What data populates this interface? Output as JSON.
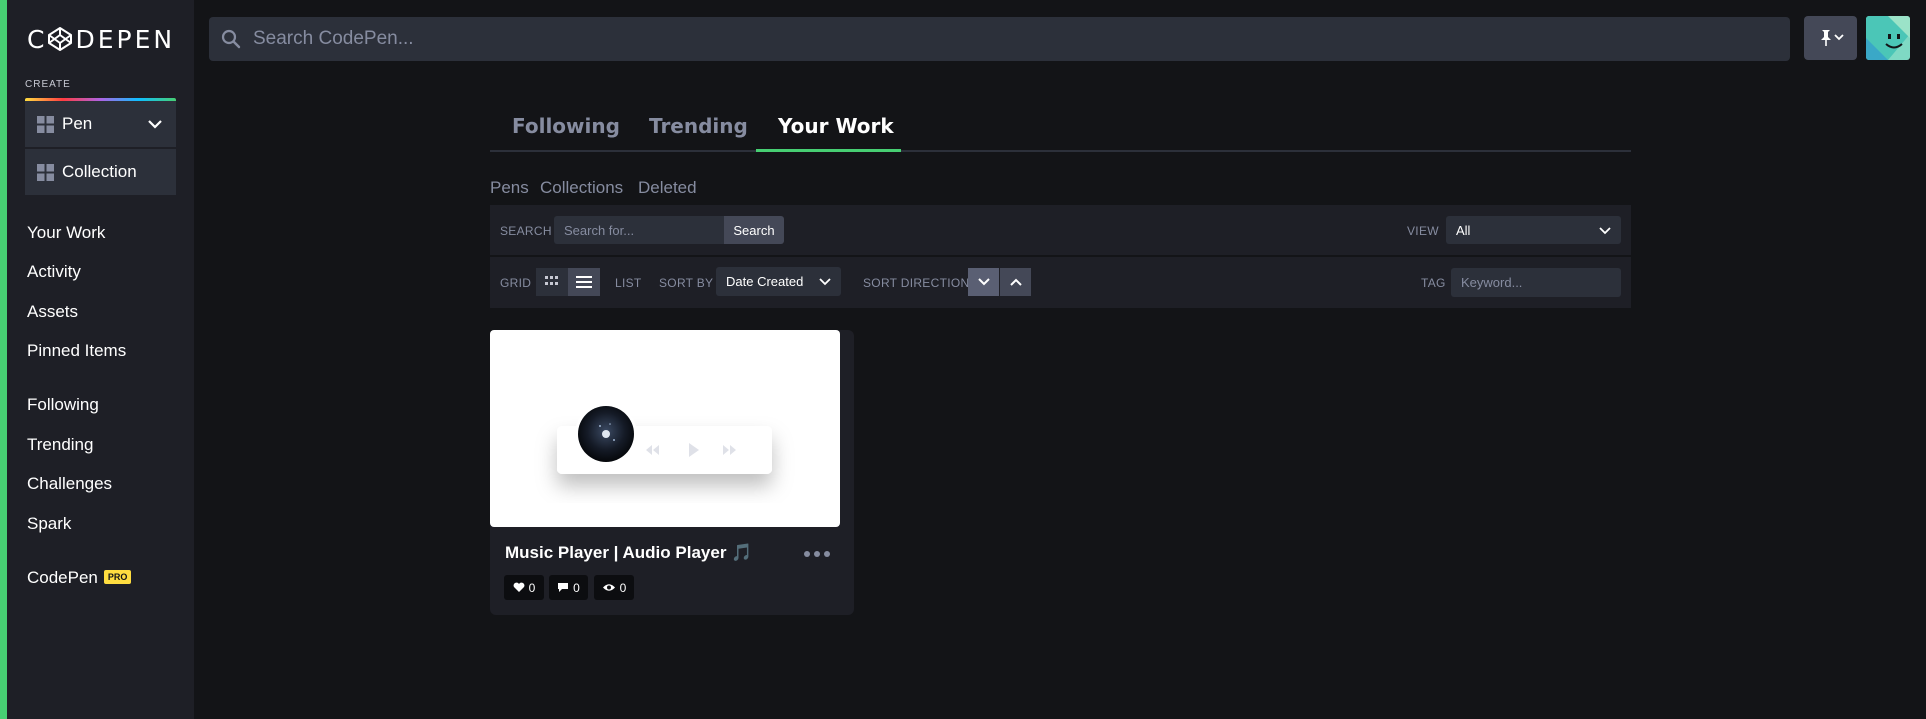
{
  "brand": {
    "logo_text": "DEPEN"
  },
  "sidebar": {
    "create_label": "CREATE",
    "create_items": [
      {
        "label": "Pen"
      },
      {
        "label": "Collection"
      }
    ],
    "nav_items": [
      {
        "label": "Your Work"
      },
      {
        "label": "Activity"
      },
      {
        "label": "Assets"
      },
      {
        "label": "Pinned Items"
      },
      {
        "label": "Following"
      },
      {
        "label": "Trending"
      },
      {
        "label": "Challenges"
      },
      {
        "label": "Spark"
      },
      {
        "label": "CodePen"
      }
    ],
    "pro_badge": "PRO"
  },
  "header": {
    "search_placeholder": "Search CodePen..."
  },
  "tabs": [
    {
      "label": "Following",
      "active": false
    },
    {
      "label": "Trending",
      "active": false
    },
    {
      "label": "Your Work",
      "active": true
    }
  ],
  "subtabs": [
    {
      "label": "Pens"
    },
    {
      "label": "Collections"
    },
    {
      "label": "Deleted"
    }
  ],
  "filters": {
    "search_label": "SEARCH",
    "search_placeholder": "Search for...",
    "search_button": "Search",
    "view_label": "VIEW",
    "view_value": "All",
    "grid_label": "GRID",
    "list_label": "LIST",
    "sort_by_label": "SORT BY",
    "sort_by_value": "Date Created",
    "sort_direction_label": "SORT DIRECTION",
    "tag_label": "TAG",
    "tag_placeholder": "Keyword..."
  },
  "pens": [
    {
      "title": "Music Player | Audio Player",
      "title_emoji": "🎵",
      "likes": "0",
      "comments": "0",
      "views": "0"
    }
  ],
  "colors": {
    "accent_green": "#47cf73",
    "pro_yellow": "#ffdd40",
    "background": "#131417",
    "sidebar": "#1e1f26"
  }
}
